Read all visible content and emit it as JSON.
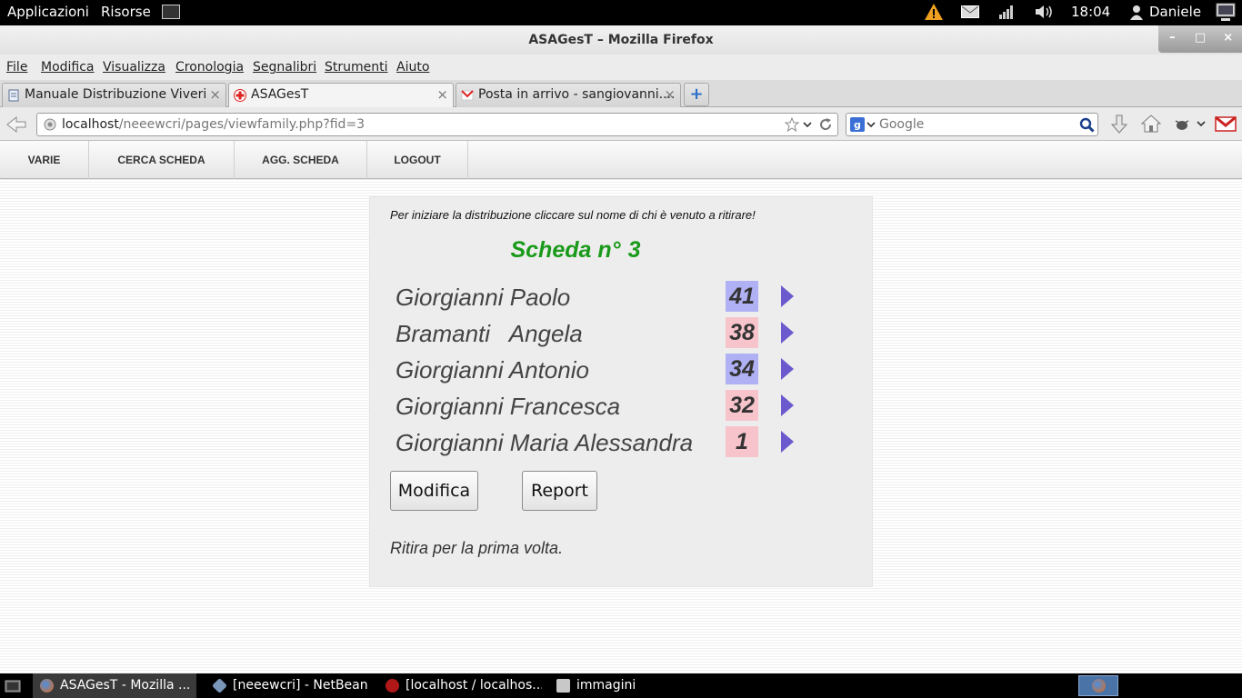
{
  "panel": {
    "applications": "Applicazioni",
    "places": "Risorse",
    "clock": "18:04",
    "user": "Daniele"
  },
  "window": {
    "title": "ASAGesT – Mozilla Firefox",
    "min": "–",
    "max": "□",
    "close": "×"
  },
  "menu": [
    "File",
    "Modifica",
    "Visualizza",
    "Cronologia",
    "Segnalibri",
    "Strumenti",
    "Aiuto"
  ],
  "tabs": [
    {
      "label": "Manuale Distribuzione Viveri"
    },
    {
      "label": "ASAGesT"
    },
    {
      "label": "Posta in arrivo - sangiovanni...."
    }
  ],
  "tab_close": "×",
  "new_tab": "+",
  "url": {
    "host": "localhost",
    "path": "/neeewcri/pages/viewfamily.php?fid=3"
  },
  "search": {
    "placeholder": "Google"
  },
  "sitenav": [
    "VARIE",
    "CERCA SCHEDA",
    "AGG. SCHEDA",
    "LOGOUT"
  ],
  "card": {
    "instruction": "Per iniziare la distribuzione cliccare sul nome di chi è venuto a ritirare!",
    "title": "Scheda n°",
    "number": "3",
    "members": [
      {
        "name": "Giorgianni Paolo",
        "age": "41",
        "color": "#b0b0f4"
      },
      {
        "name": "Bramanti   Angela",
        "age": "38",
        "color": "#f8c4cc"
      },
      {
        "name": "Giorgianni Antonio",
        "age": "34",
        "color": "#b0b0f4"
      },
      {
        "name": "Giorgianni Francesca",
        "age": "32",
        "color": "#f8c4cc"
      },
      {
        "name": "Giorgianni Maria Alessandra",
        "age": "1",
        "color": "#f8c4cc"
      }
    ],
    "buttons": {
      "edit": "Modifica",
      "report": "Report"
    },
    "status": "Ritira per la prima volta."
  },
  "taskbar": [
    {
      "label": "ASAGesT - Mozilla ..."
    },
    {
      "label": "[neeewcri] - NetBean..."
    },
    {
      "label": "[localhost / localhos..."
    },
    {
      "label": "immagini"
    }
  ]
}
